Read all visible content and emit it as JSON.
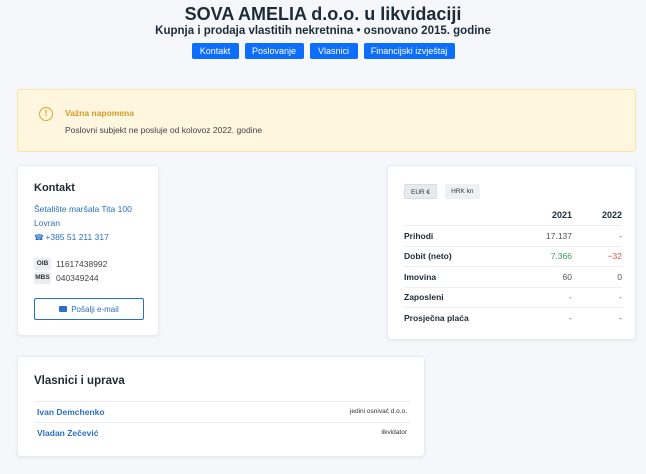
{
  "header": {
    "title": "SOVA AMELIA d.o.o. u likvidaciji",
    "subtitle": "Kupnja i prodaja vlastitih nekretnina • osnovano 2015. godine"
  },
  "nav": [
    "Kontakt",
    "Poslovanje",
    "Vlasnici",
    "Financijski izvještaj"
  ],
  "alert": {
    "title": "Važna napomena",
    "text": "Poslovni subjekt ne posluje od kolovoz 2022. godine",
    "color": "#d49a27"
  },
  "contact": {
    "heading": "Kontakt",
    "address_line1": "Šetalište maršala Tita 100",
    "address_line2": "Lovran",
    "phone": "+385 51 211 317",
    "oib_label": "OIB",
    "oib": "11617438992",
    "mbs_label": "MBS",
    "mbs": "040349244",
    "email_button": "Pošalji e-mail"
  },
  "financials": {
    "tabs": [
      "EUR €",
      "HRK kn"
    ],
    "active_tab": "EUR €",
    "columns": [
      "2021",
      "2022"
    ],
    "rows": [
      {
        "label": "Prihodi",
        "v2021": "17.137",
        "v2022": "-"
      },
      {
        "label": "Dobit (neto)",
        "v2021": "7.366",
        "v2022": "−32"
      },
      {
        "label": "Imovina",
        "v2021": "60",
        "v2022": "0"
      },
      {
        "label": "Zaposleni",
        "v2021": "-",
        "v2022": "-"
      },
      {
        "label": "Prosječna plaća",
        "v2021": "-",
        "v2022": "-"
      }
    ]
  },
  "owners": {
    "heading": "Vlasnici i uprava",
    "items": [
      {
        "name": "Ivan Demchenko",
        "role": "jedini osnivač d.o.o."
      },
      {
        "name": "Vladan Zečević",
        "role": "likvidator"
      }
    ]
  },
  "colors": {
    "accent": "#0d6efd",
    "link": "#2a6fc2",
    "positive": "#3aa160",
    "negative": "#d9534f"
  }
}
